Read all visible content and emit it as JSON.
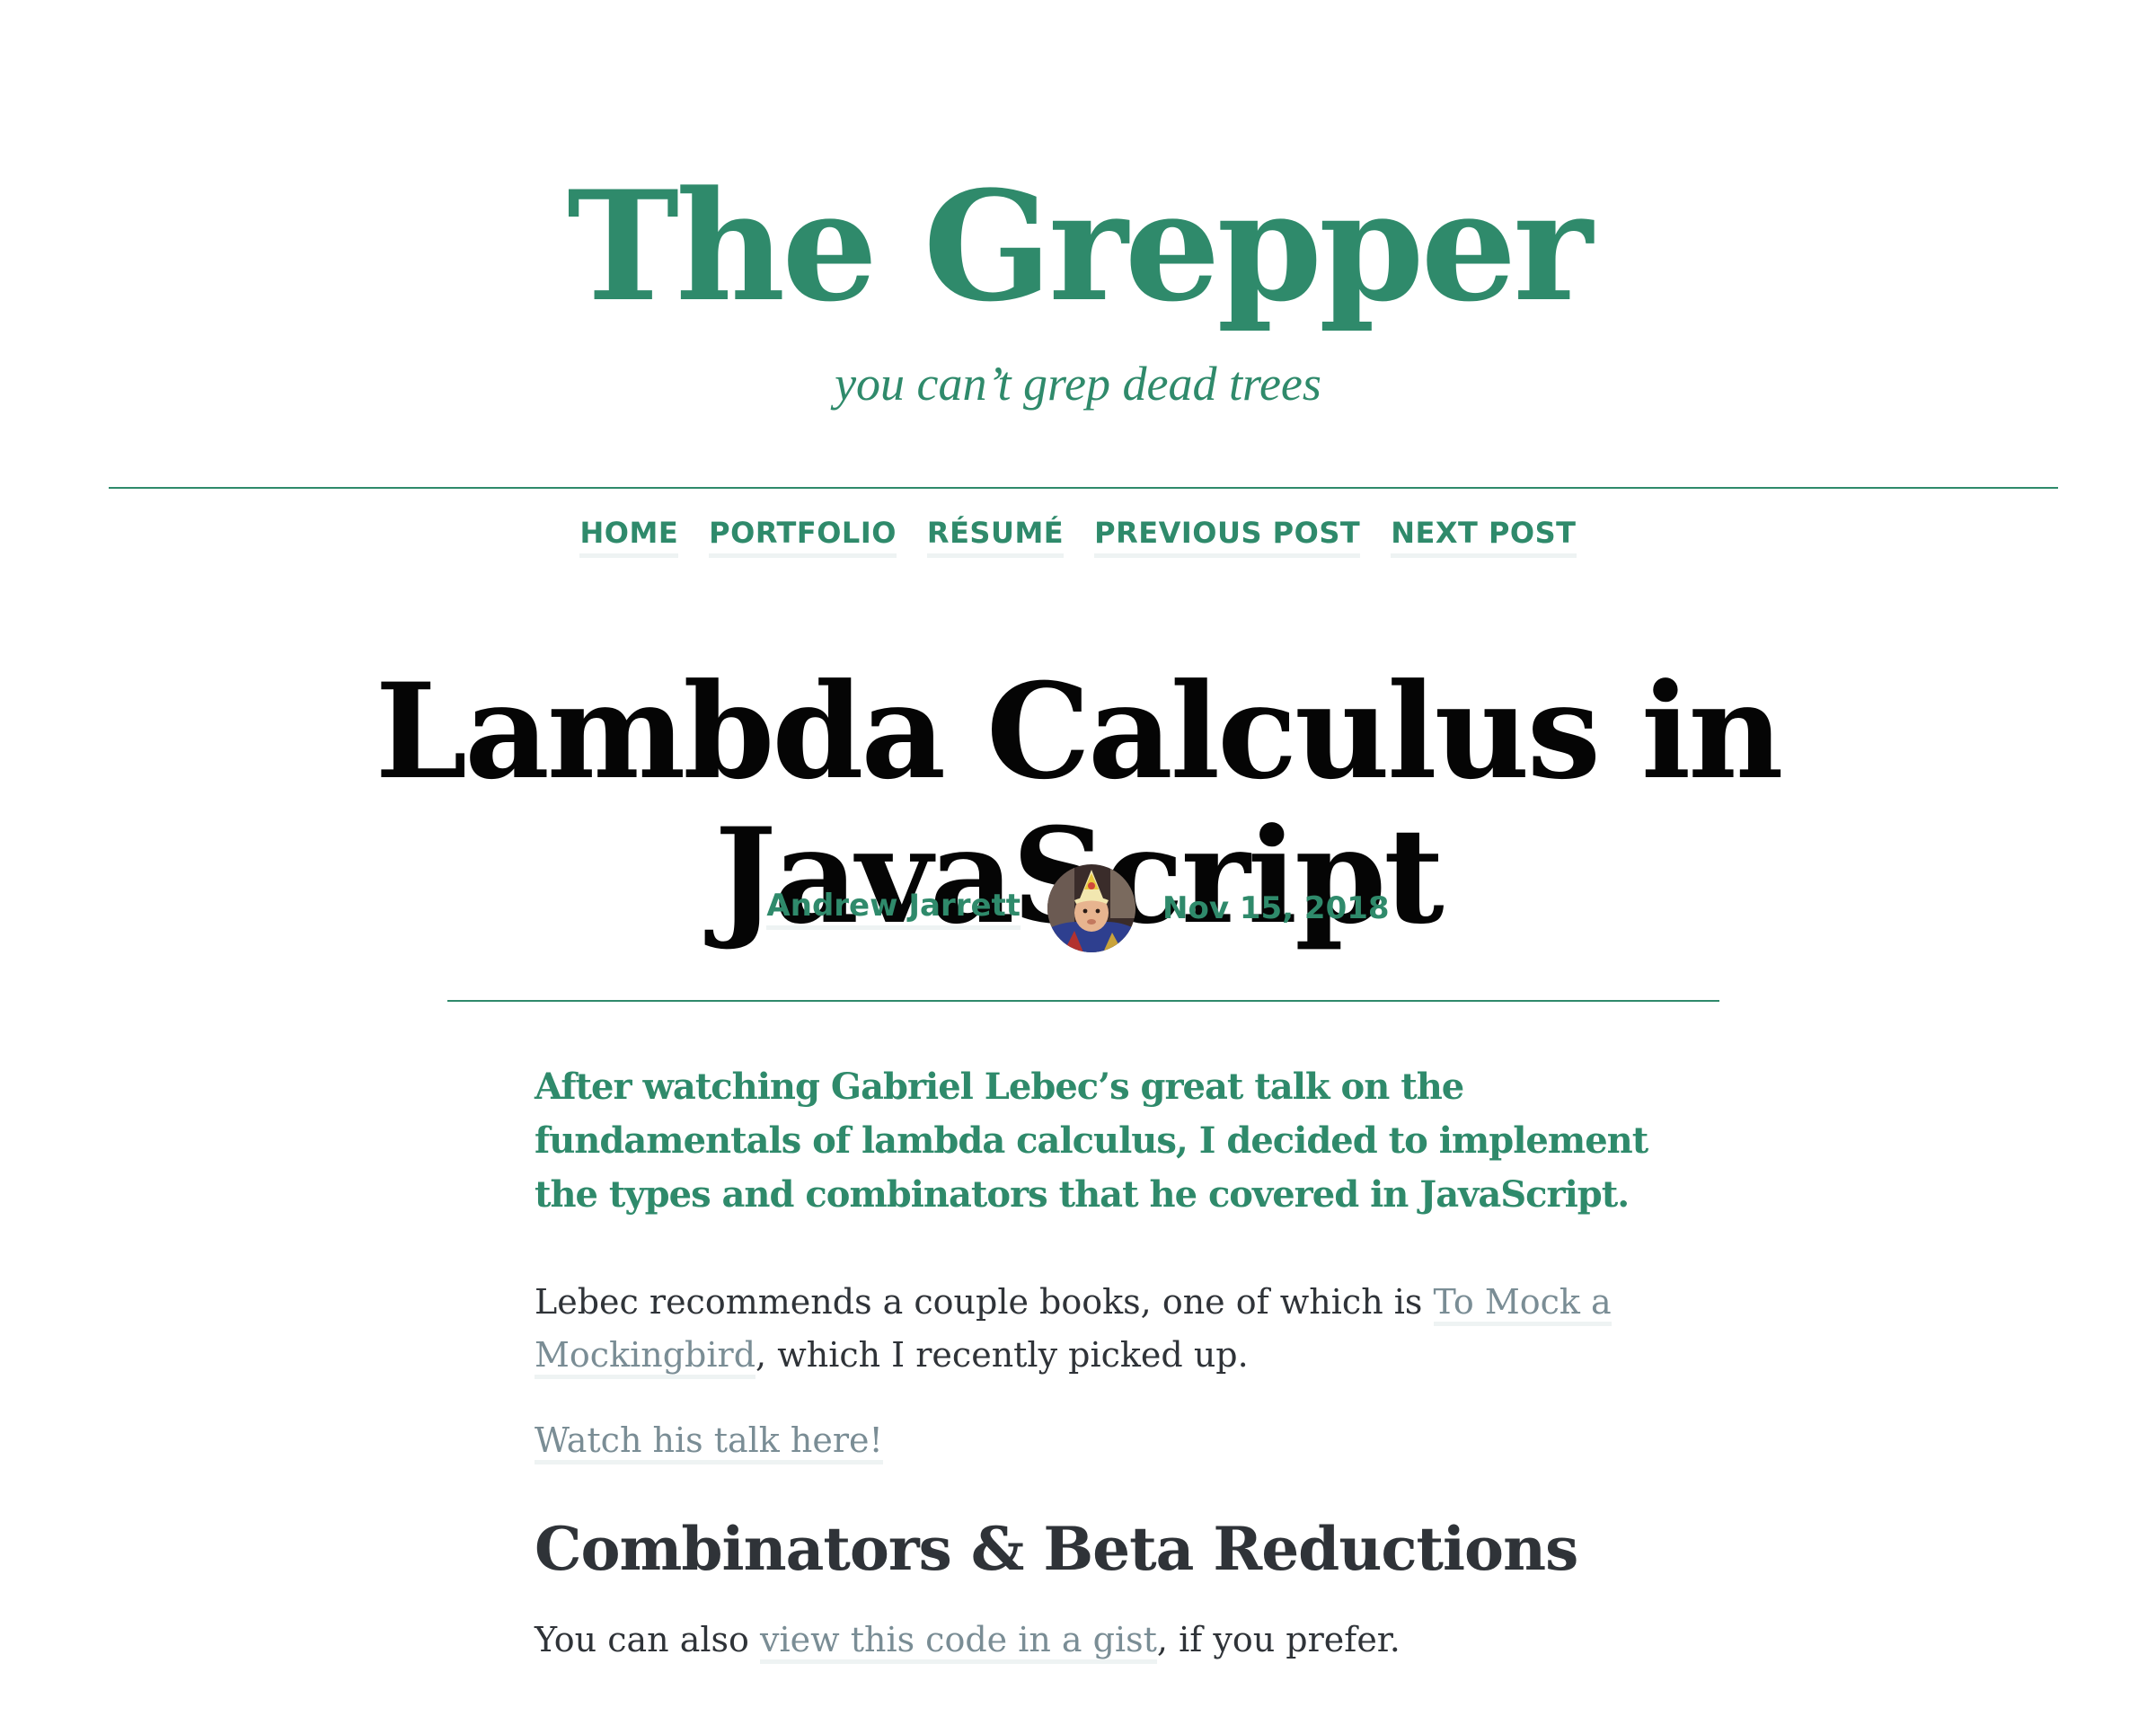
{
  "site": {
    "title": "The Grepper",
    "tagline": "you can’t grep dead trees"
  },
  "nav": {
    "items": [
      {
        "label": "HOME"
      },
      {
        "label": "PORTFOLIO"
      },
      {
        "label": "RÉSUMÉ"
      },
      {
        "label": "PREVIOUS POST"
      },
      {
        "label": "NEXT POST"
      }
    ]
  },
  "post": {
    "title": "Lambda Calculus in JavaScript",
    "author": "Andrew Jarrett",
    "date": "Nov 15, 2018",
    "lede": "After watching Gabriel Lebec’s great talk on the fundamentals of lambda calculus, I decided to implement the types and combinators that he covered in JavaScript.",
    "paragraph1": {
      "before": "Lebec recommends a couple books, one of which is ",
      "link": "To Mock a Mockingbird",
      "after": ", which I recently picked up."
    },
    "paragraph2": {
      "link": "Watch his talk here!"
    },
    "section_heading": "Combinators & Beta Reductions",
    "paragraph3": {
      "before": "You can also ",
      "link": "view this code in a gist",
      "after": ", if you prefer."
    }
  },
  "colors": {
    "accent": "#2f8a6b",
    "title": "#050505",
    "body_text": "#2f3338",
    "link": "#7a8d95",
    "link_underline": "#eef3f3"
  }
}
